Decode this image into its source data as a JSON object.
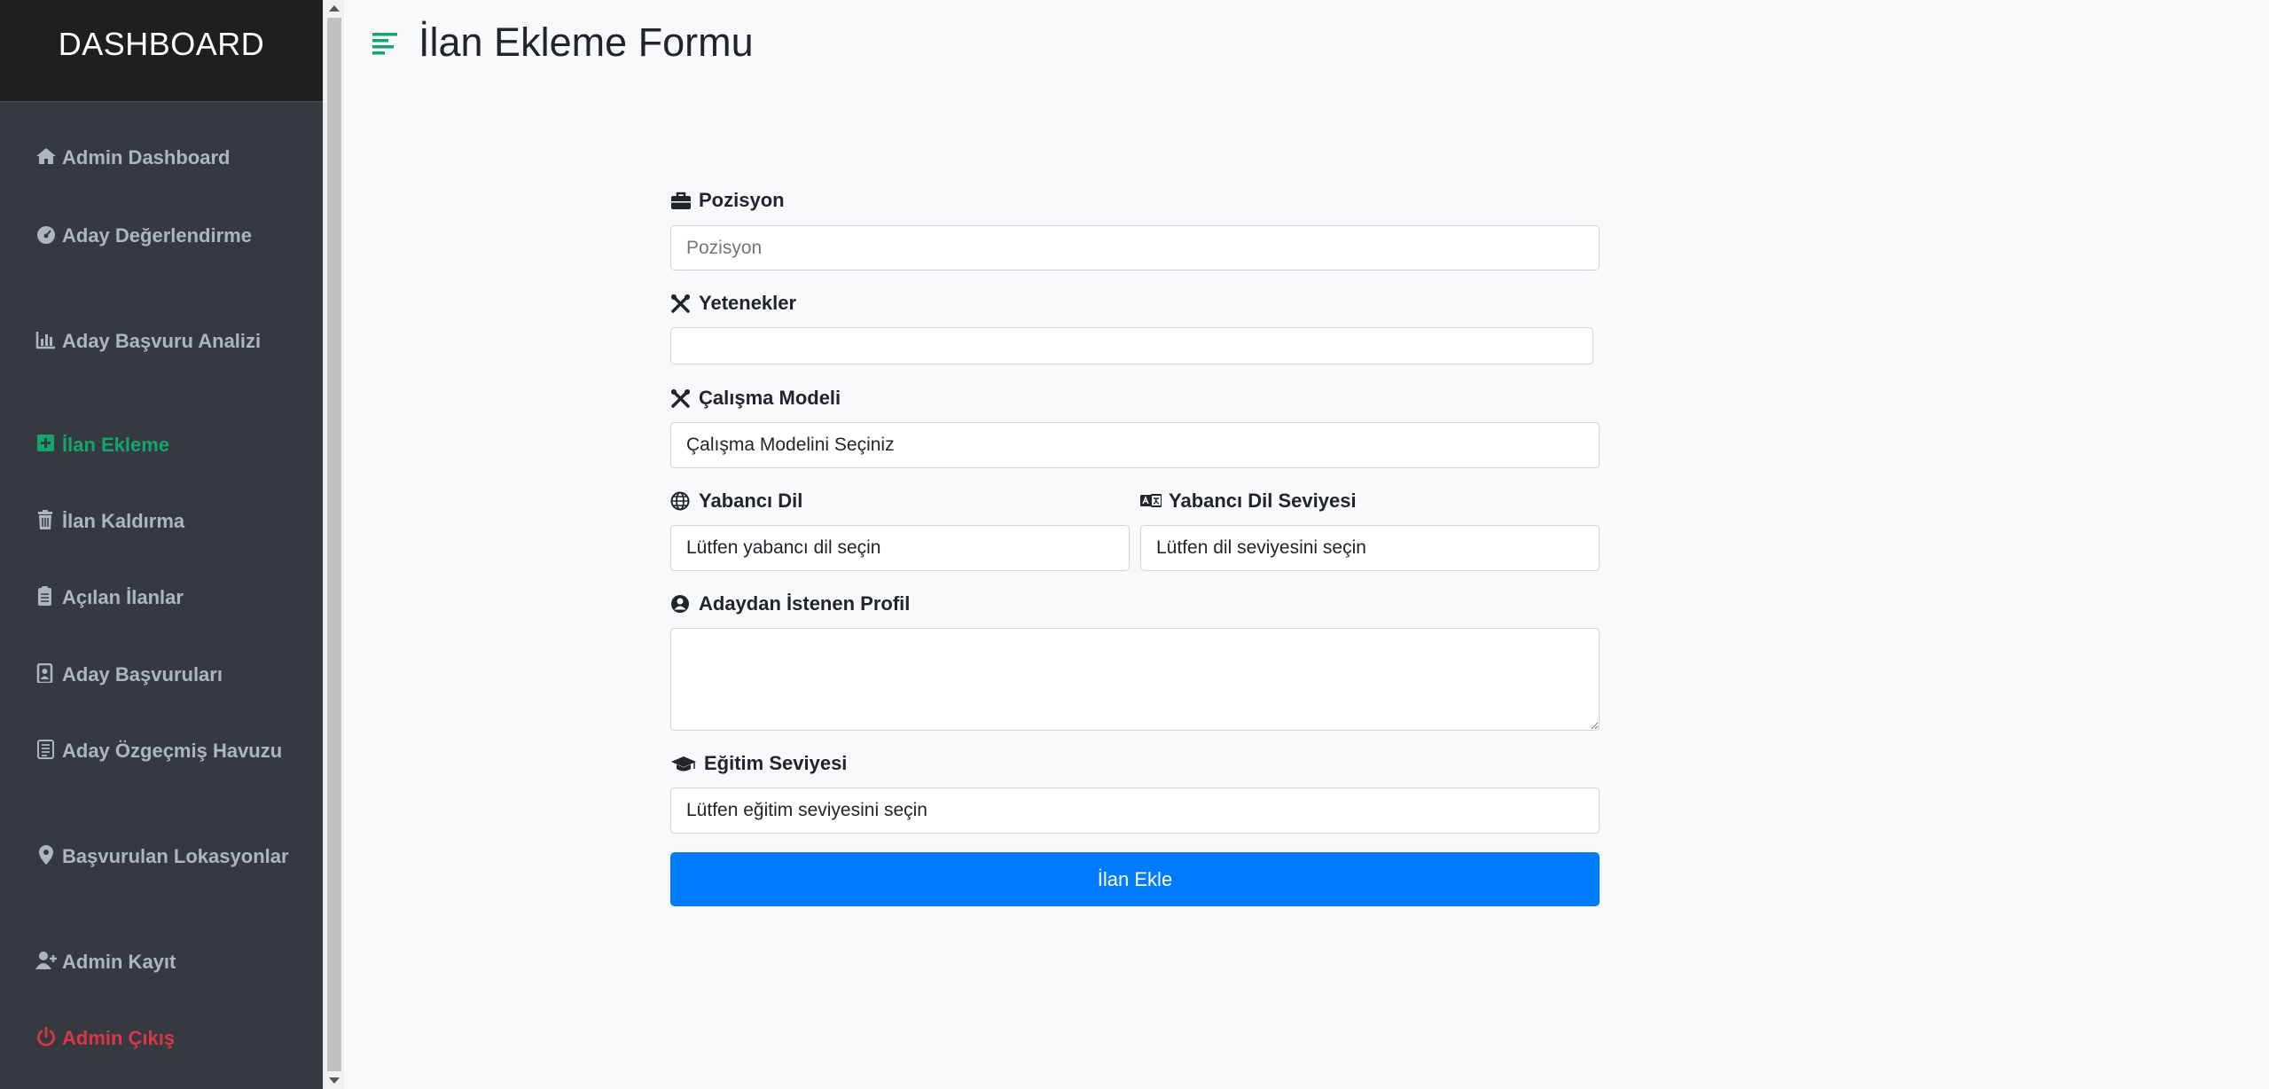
{
  "sidebar": {
    "title": "DASHBOARD",
    "items": [
      {
        "label": "Admin Dashboard",
        "icon": "home-icon"
      },
      {
        "label": "Aday Değerlendirme",
        "icon": "gauge-icon"
      },
      {
        "label": "Aday Başvuru Analizi",
        "icon": "bar-chart-icon"
      },
      {
        "label": "İlan Ekleme",
        "icon": "plus-square-icon"
      },
      {
        "label": "İlan Kaldırma",
        "icon": "trash-icon"
      },
      {
        "label": "Açılan İlanlar",
        "icon": "clipboard-icon"
      },
      {
        "label": "Aday Başvuruları",
        "icon": "id-file-icon"
      },
      {
        "label": "Aday Özgeçmiş Havuzu",
        "icon": "document-icon"
      },
      {
        "label": "Başvurulan Lokasyonlar",
        "icon": "map-pin-icon"
      },
      {
        "label": "Admin Kayıt",
        "icon": "user-plus-icon"
      },
      {
        "label": "Admin Çıkış",
        "icon": "power-icon"
      }
    ]
  },
  "page": {
    "title": "İlan Ekleme Formu"
  },
  "form": {
    "pozisyon_label": "Pozisyon",
    "pozisyon_placeholder": "Pozisyon",
    "yetenekler_label": "Yetenekler",
    "calisma_modeli_label": "Çalışma Modeli",
    "calisma_modeli_value": "Çalışma Modelini Seçiniz",
    "yabanci_dil_label": "Yabancı Dil",
    "yabanci_dil_value": "Lütfen yabancı dil seçin",
    "dil_seviyesi_label": "Yabancı Dil Seviyesi",
    "dil_seviyesi_value": "Lütfen dil seviyesini seçin",
    "profil_label": "Adaydan İstenen Profil",
    "egitim_label": "Eğitim Seviyesi",
    "egitim_value": "Lütfen eğitim seviyesini seçin",
    "submit_label": "İlan Ekle"
  },
  "colors": {
    "sidebar_bg": "#343a40",
    "active": "#12a66b",
    "danger": "#dc3545",
    "primary": "#007bff"
  }
}
